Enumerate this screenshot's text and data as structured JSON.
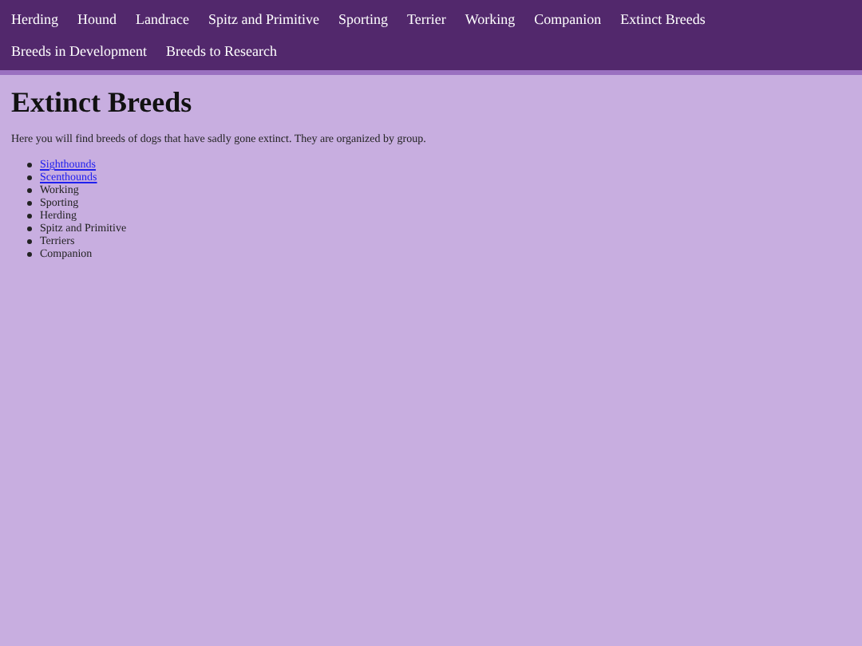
{
  "nav": {
    "items": [
      {
        "label": "Herding"
      },
      {
        "label": "Hound"
      },
      {
        "label": "Landrace"
      },
      {
        "label": "Spitz and Primitive"
      },
      {
        "label": "Sporting"
      },
      {
        "label": "Terrier"
      },
      {
        "label": "Working"
      },
      {
        "label": "Companion"
      },
      {
        "label": "Extinct Breeds"
      },
      {
        "label": "Breeds in Development"
      },
      {
        "label": "Breeds to Research"
      }
    ]
  },
  "heading": "Extinct Breeds",
  "intro": "Here you will find breeds of dogs that have sadly gone extinct. They are organized by group.",
  "groups": [
    {
      "label": "Sighthounds",
      "kind": "link"
    },
    {
      "label": "Scenthounds",
      "kind": "link"
    },
    {
      "label": "Working",
      "kind": "text"
    },
    {
      "label": "Sporting",
      "kind": "text"
    },
    {
      "label": "Herding",
      "kind": "text"
    },
    {
      "label": "Spitz and Primitive",
      "kind": "text"
    },
    {
      "label": "Terriers",
      "kind": "text"
    },
    {
      "label": "Companion",
      "kind": "text"
    }
  ]
}
